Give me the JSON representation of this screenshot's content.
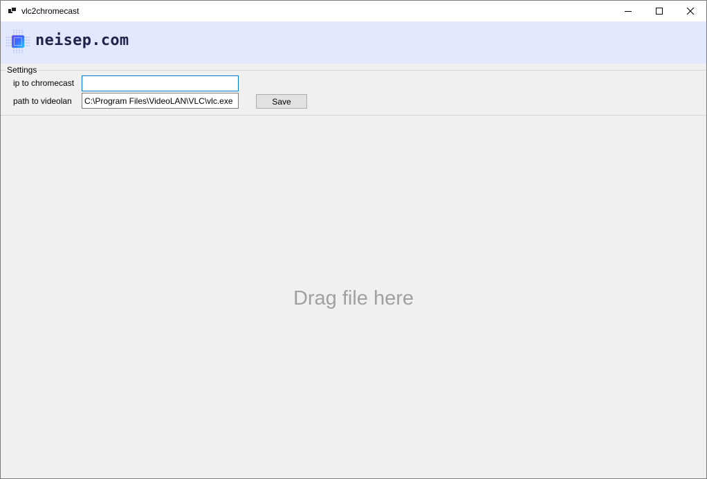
{
  "window": {
    "title": "vlc2chromecast",
    "icon": "app-window-icon",
    "controls": [
      "minimize-icon",
      "maximize-icon",
      "close-icon"
    ]
  },
  "banner": {
    "brand": "neisep.com",
    "logo": "chip-logo-icon",
    "background_color": "#e3e8ff"
  },
  "settings": {
    "legend": "Settings",
    "ip_label": "ip to chromecast",
    "ip_value": "",
    "path_label": "path to videolan",
    "path_value": "C:\\Program Files\\VideoLAN\\VLC\\vlc.exe",
    "save_label": "Save"
  },
  "drop_area": {
    "text": "Drag file here"
  },
  "colors": {
    "focus_border": "#0078d7",
    "brand_text": "#22224a",
    "hint_text": "#a0a0a0"
  }
}
